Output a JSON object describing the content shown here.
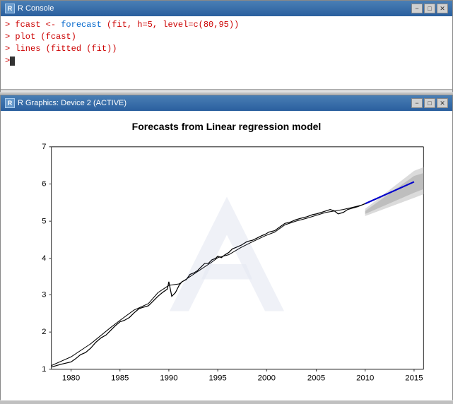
{
  "console_window": {
    "title": "R Console",
    "title_icon": "R",
    "lines": [
      {
        "prompt": "> ",
        "code": "fcast <- forecast (fit, h=5, level=c(80,95))"
      },
      {
        "prompt": "> ",
        "code": "plot (fcast)"
      },
      {
        "prompt": "> ",
        "code": "lines (fitted (fit))"
      },
      {
        "prompt": "> ",
        "code": ""
      }
    ],
    "btn_min": "−",
    "btn_max": "□",
    "btn_close": "✕"
  },
  "graphics_window": {
    "title": "R Graphics: Device 2 (ACTIVE)",
    "title_icon": "R",
    "chart_title": "Forecasts from Linear regression model",
    "btn_min": "−",
    "btn_max": "□",
    "btn_close": "✕",
    "y_labels": [
      "1",
      "2",
      "3",
      "4",
      "5",
      "6",
      "7"
    ],
    "x_labels": [
      "1980",
      "1985",
      "1990",
      "1995",
      "2000",
      "2005",
      "2010",
      "2015"
    ]
  }
}
